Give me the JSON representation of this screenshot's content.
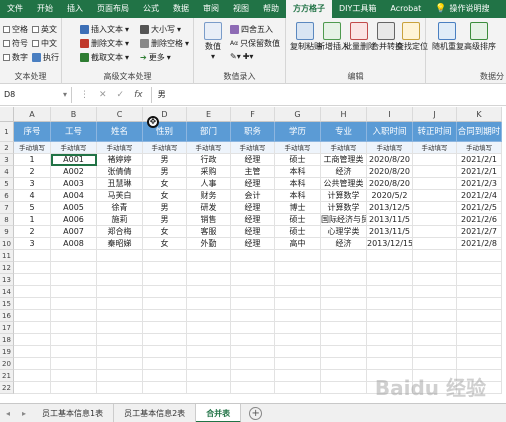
{
  "ribbon_tabs": [
    "文件",
    "开始",
    "插入",
    "页面布局",
    "公式",
    "数据",
    "审阅",
    "视图",
    "帮助",
    "方方格子",
    "DIY工具箱",
    "Acrobat",
    "操作说明搜"
  ],
  "active_tab": "方方格子",
  "ribbon": {
    "text_group": {
      "label": "文本处理",
      "checks": [
        "空格",
        "英文",
        "符号",
        "中文",
        "数字",
        "执行"
      ]
    },
    "advanced_group": {
      "label": "高级文本处理",
      "items": [
        "插入文本",
        "大小写",
        "删除文本",
        "删除空格",
        "截取文本",
        "更多"
      ]
    },
    "numeric_group": {
      "label": "数值录入",
      "items": [
        "数值",
        "四舍五入",
        "只保留数值"
      ]
    },
    "edit_group": {
      "label": "编辑",
      "items": [
        "复制粘贴",
        "新增插入",
        "批量删除",
        "合并转换",
        "查找定位"
      ]
    },
    "analysis_group": {
      "label": "数据分",
      "items": [
        "随机重复",
        "高级排序"
      ]
    }
  },
  "formula_bar": {
    "name_box": "D8",
    "fx_label": "fx",
    "content": "男"
  },
  "columns": [
    "A",
    "B",
    "C",
    "D",
    "E",
    "F",
    "G",
    "H",
    "I",
    "J",
    "K"
  ],
  "row_numbers": [
    "1",
    "2",
    "3",
    "4",
    "5",
    "6",
    "7",
    "8",
    "9",
    "10",
    "11",
    "12",
    "13",
    "14",
    "15",
    "16",
    "17",
    "18",
    "19",
    "20",
    "21",
    "22"
  ],
  "table_headers": [
    "序号",
    "工号",
    "姓名",
    "性别",
    "部门",
    "职务",
    "学历",
    "专业",
    "入职时间",
    "转正时间",
    "合同到期时"
  ],
  "note_row": [
    "手动填写",
    "手动填写",
    "手动填写",
    "手动填写",
    "手动填写",
    "手动填写",
    "手动填写",
    "手动填写",
    "手动填写",
    "手动填写",
    "手动填写"
  ],
  "rows": [
    [
      "1",
      "A001",
      "褚婷婷",
      "男",
      "行政",
      "经理",
      "硕士",
      "工商管理类",
      "2020/8/20",
      "",
      "2021/2/1"
    ],
    [
      "2",
      "A002",
      "张倩倩",
      "男",
      "采购",
      "主管",
      "本科",
      "经济",
      "2020/8/20",
      "",
      "2021/2/1"
    ],
    [
      "3",
      "A003",
      "丑慧琳",
      "女",
      "人事",
      "经理",
      "本科",
      "公共管理类",
      "2020/8/20",
      "",
      "2021/2/3"
    ],
    [
      "4",
      "A004",
      "马芙白",
      "女",
      "财务",
      "会计",
      "本科",
      "计算数学",
      "2020/5/2",
      "",
      "2021/2/4"
    ],
    [
      "5",
      "A005",
      "徐青",
      "男",
      "研发",
      "经理",
      "博士",
      "计算数学",
      "2013/12/5",
      "",
      "2021/2/5"
    ],
    [
      "1",
      "A006",
      "施莉",
      "男",
      "销售",
      "经理",
      "硕士",
      "国际经济与贸易",
      "2013/11/5",
      "",
      "2021/2/6"
    ],
    [
      "2",
      "A007",
      "郑合梅",
      "女",
      "客服",
      "经理",
      "硕士",
      "心理学类",
      "2013/11/5",
      "",
      "2021/2/7"
    ],
    [
      "3",
      "A008",
      "秦昭娣",
      "女",
      "外勤",
      "经理",
      "高中",
      "经济",
      "2013/12/15",
      "",
      "2021/2/8"
    ]
  ],
  "sheet_tabs": [
    "员工基本信息1表",
    "员工基本信息2表",
    "合并表"
  ],
  "active_sheet": "合并表",
  "watermark": "Baidu 经验",
  "colors": {
    "ribbon_green": "#217346",
    "header_blue": "#5b9bd5"
  }
}
